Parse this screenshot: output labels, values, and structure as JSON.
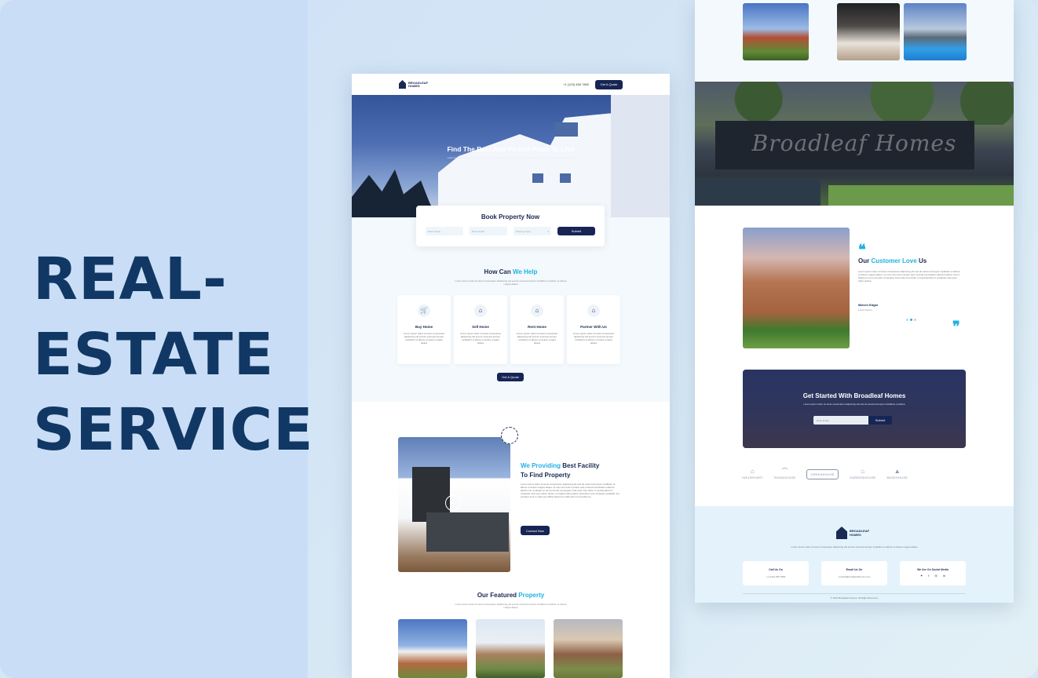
{
  "headline": [
    "REAL-",
    "ESTATE",
    "SERVICE"
  ],
  "colors": {
    "navy": "#162554",
    "accent": "#22b0e3",
    "headline": "#113864"
  },
  "landing": {
    "logo_line1": "BROADLEAF",
    "logo_line2": "HOMES",
    "phone": "+1 (123) 456 7890",
    "nav_button": "Get A Quote",
    "hero_title": "Find The Best And Perfect Place To Live",
    "hero_sub": "Lorem ipsum dolor sit amet consectetur adipiscing elit sed do eiusmod tempor incididunt ut labore et dolore magna aliqua",
    "book_title": "Book Property Now",
    "book_fields": {
      "name": "Enter Name",
      "email": "Enter Email",
      "type": "Property Type"
    },
    "book_button": "Submit",
    "help_title_1": "How Can",
    "help_title_2": "We Help",
    "help_sub": "Lorem ipsum dolor sit amet consectetur adipiscing elit sed do eiusmod tempor incididunt ut labore et dolore magna aliqua",
    "services": [
      {
        "icon": "cart-icon",
        "glyph": "🛒",
        "title": "Buy Home",
        "desc": "Lorem ipsum dolor sit amet consectetur adipiscing elit sed do eiusmod tempor incididunt ut labore et dolore magna aliqua"
      },
      {
        "icon": "sell-home-icon",
        "glyph": "⌂",
        "title": "Sell Home",
        "desc": "Lorem ipsum dolor sit amet consectetur adipiscing elit sed do eiusmod tempor incididunt ut labore et dolore magna aliqua"
      },
      {
        "icon": "rent-home-icon",
        "glyph": "⌂",
        "title": "Rent Home",
        "desc": "Lorem ipsum dolor sit amet consectetur adipiscing elit sed do eiusmod tempor incididunt ut labore et dolore magna aliqua"
      },
      {
        "icon": "partner-icon",
        "glyph": "⌂",
        "title": "Partner With Us",
        "desc": "Lorem ipsum dolor sit amet consectetur adipiscing elit sed do eiusmod tempor incididunt ut labore et dolore magna aliqua"
      }
    ],
    "quote_button": "Get A Quote",
    "provide_title_1": "We Providing",
    "provide_title_2": "Best Facility",
    "provide_title_3": "To Find Property",
    "provide_text": "Lorem ipsum dolor sit amet consectetur adipiscing elit sed do eiusmod tempor incididunt ut labore et dolore magna aliqua. Ut enim ad minim veniam quis nostrud exercitation ullamco laboris nisi ut aliquip ex ea commodo consequat. Duis aute irure dolor in reprehenderit in voluptate velit esse cillum dolore eu fugiat nulla pariatur. Excepteur sint occaecat cupidatat non proident sunt in culpa qui officia deserunt mollit anim id est laborum.",
    "provide_button": "Contact Now",
    "featured_title_1": "Our Featured",
    "featured_title_2": "Property",
    "featured_sub": "Lorem ipsum dolor sit amet consectetur adipiscing elit sed do eiusmod tempor incididunt ut labore et dolore magna aliqua"
  },
  "page2": {
    "banner_text": "Broadleaf Homes",
    "testimonial_title_1": "Our",
    "testimonial_title_2": "Customer Love",
    "testimonial_title_3": "Us",
    "testimonial_text": "Lorem ipsum dolor sit amet consectetur adipiscing elit sed do eiusmod tempor incididunt ut labore et dolore magna aliqua. Ut enim ad minim veniam quis nostrud exercitation ullamco laboris nisi ut aliquip ex ea commodo consequat. Duis aute irure dolor in reprehenderit in voluptate velit esse cillum dolore.",
    "testimonial_name": "Marvin Edgar",
    "testimonial_role": "Lorem Ipsum",
    "cta_title": "Get Started With Broadleaf Homes",
    "cta_sub": "Lorem ipsum dolor sit amet consectetur adipiscing elit sed do eiusmod tempor incididunt ut labore",
    "cta_placeholder": "Enter Email",
    "cta_button": "Submit",
    "brands": [
      "HOUSEHART",
      "ROADHOUSE",
      "GREENHOUSE",
      "GARDENHOUSE",
      "BASEHOUSE"
    ],
    "footer_desc": "Lorem ipsum dolor sit amet consectetur adipiscing elit sed do eiusmod tempor incididunt ut labore et dolore magna aliqua",
    "call_title": "Call Us On",
    "call_value": "+1 (123) 456 7890",
    "email_title": "Email Us On",
    "email_value": "contact@broadleafhomes.com",
    "social_title": "We Are On Social Media",
    "copyright": "© 2023 Broadleaf Homes. All Right Reserved."
  }
}
